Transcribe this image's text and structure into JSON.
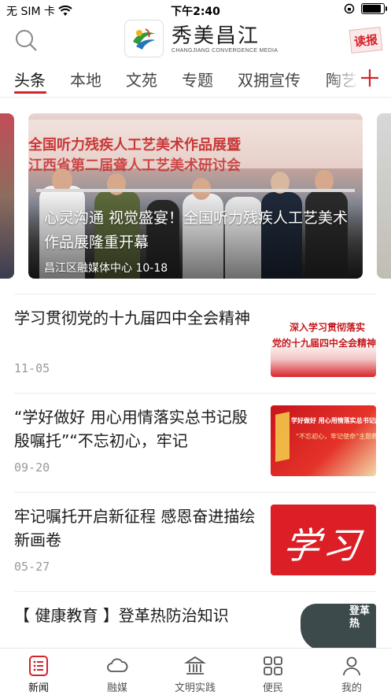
{
  "status_bar": {
    "carrier": "无 SIM 卡",
    "time": "下午2:40",
    "battery_level": 0.9
  },
  "header": {
    "logo_title": "秀美昌江",
    "logo_subtitle": "CHANGJIANG CONVERGENCE MEDIA",
    "right_badge": "读报",
    "search_icon": "search-icon"
  },
  "tabs": {
    "items": [
      "头条",
      "本地",
      "文苑",
      "专题",
      "双拥宣传",
      "陶艺"
    ],
    "active_index": 0,
    "add_icon": "plus-icon"
  },
  "carousel": {
    "title": "心灵沟通  视觉盛宴！全国听力残疾人工艺美术作品展隆重开幕",
    "source": "昌江区融媒体中心",
    "date": "10-18",
    "banner_line1": "全国听力残疾人工艺美术作品展暨",
    "banner_line2": "江西省第二届聋人工艺美术研讨会"
  },
  "news": [
    {
      "title": "学习贯彻党的十九届四中全会精神",
      "date": "11-05",
      "thumb_line1": "深入学习贯彻落实",
      "thumb_line2": "党的十九届四中全会精神"
    },
    {
      "title": "“学好做好  用心用情落实总书记殷殷嘱托”“不忘初心，牢记",
      "date": "09-20",
      "thumb_line1": "学好做好  用心用情落实总书记殷殷嘱托",
      "thumb_line2": "“不忘初心，牢记使命”主题教育学校"
    },
    {
      "title": "牢记嘱托开启新征程  感恩奋进描绘新画卷",
      "date": "05-27",
      "thumb_text": "学习"
    },
    {
      "title": "【 健康教育 】登革热防治知识",
      "date": "",
      "thumb_text": "登革热"
    }
  ],
  "bottom_nav": {
    "items": [
      {
        "label": "新闻",
        "icon": "news-list-icon"
      },
      {
        "label": "融媒",
        "icon": "cloud-icon"
      },
      {
        "label": "文明实践",
        "icon": "building-icon"
      },
      {
        "label": "便民",
        "icon": "grid-icon"
      },
      {
        "label": "我的",
        "icon": "person-icon"
      }
    ],
    "active_index": 0
  },
  "colors": {
    "accent": "#d4232a",
    "text": "#1b1b1b",
    "muted": "#999999"
  }
}
